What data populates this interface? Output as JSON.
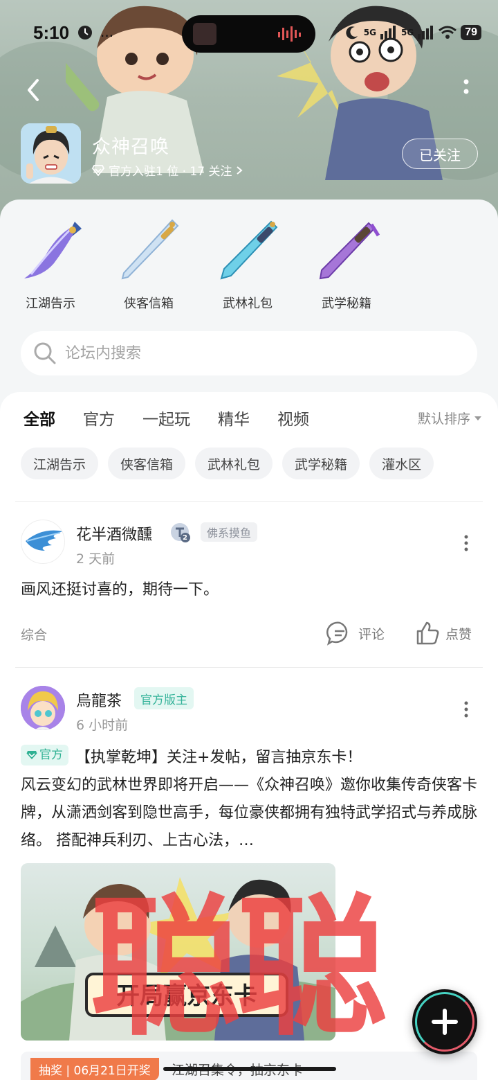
{
  "status_bar": {
    "time": "5:10",
    "extra": "...",
    "battery": "79",
    "network_1": "5G",
    "network_2": "5G"
  },
  "forum": {
    "title": "众神召唤",
    "subtitle": "官方入驻1 位 · 17 关注",
    "follow_label": "已关注"
  },
  "shortcuts": [
    {
      "label": "江湖告示",
      "icon": "purple-saber-icon"
    },
    {
      "label": "侠客信箱",
      "icon": "silver-sword-icon"
    },
    {
      "label": "武林礼包",
      "icon": "ice-blade-icon"
    },
    {
      "label": "武学秘籍",
      "icon": "violet-sword-icon"
    }
  ],
  "search": {
    "placeholder": "论坛内搜索"
  },
  "tabs": [
    {
      "label": "全部",
      "active": true
    },
    {
      "label": "官方",
      "active": false
    },
    {
      "label": "一起玩",
      "active": false
    },
    {
      "label": "精华",
      "active": false
    },
    {
      "label": "视频",
      "active": false
    }
  ],
  "sort_label": "默认排序",
  "chips": [
    "江湖告示",
    "侠客信箱",
    "武林礼包",
    "武学秘籍",
    "灌水区"
  ],
  "posts": [
    {
      "author": "花半酒微醺",
      "level_badge": "2",
      "tag": "佛系摸鱼",
      "time": "2 天前",
      "body": "画风还挺讨喜的，期待一下。",
      "category": "综合",
      "comment_label": "评论",
      "like_label": "点赞"
    },
    {
      "author": "烏龍茶",
      "tag": "官方版主",
      "time": "6 小时前",
      "official_tag": "官方",
      "title": "【执掌乾坤】关注+发帖，留言抽京东卡！",
      "body": "风云变幻的武林世界即将开启——《众神召唤》邀你收集传奇侠客卡牌，从潇洒剑客到隐世高手，每位豪侠都拥有独特武学招式与养成脉络。 搭配神兵利刃、上古心法，…",
      "image_banner_text": "开局赢京东卡",
      "lottery_tag": "抽奖 | 06月21日开奖",
      "lottery_text": "江湖召集令，抽京东卡"
    }
  ],
  "watermark": "聪聪",
  "colors": {
    "accent": "#5ed2c3",
    "official": "#2fb193",
    "lottery": "#f07a4a",
    "watermark": "#eb4040"
  }
}
